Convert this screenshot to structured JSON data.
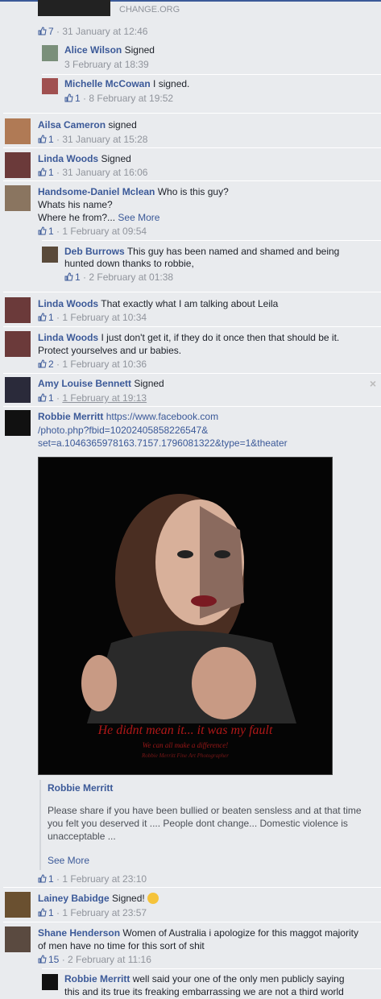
{
  "top_banner": {
    "source": "CHANGE.ORG",
    "likes": "7",
    "date": "31 January at 12:46"
  },
  "replies_1": [
    {
      "name": "Alice Wilson",
      "text": "Signed",
      "likes": "",
      "date": "3 February at 18:39"
    },
    {
      "name": "Michelle McCowan",
      "text": "I signed.",
      "likes": "1",
      "date": "8 February at 19:52"
    }
  ],
  "comments": [
    {
      "name": "Ailsa Cameron",
      "text": "signed",
      "likes": "1",
      "date": "31 January at 15:28"
    },
    {
      "name": "Linda Woods",
      "text": "Signed",
      "likes": "1",
      "date": "31 January at 16:06"
    },
    {
      "name": "Handsome-Daniel Mclean",
      "text": "Who is this guy?",
      "line2": "Whats his name?",
      "line3": "Where he from?...",
      "see_more": "See More",
      "likes": "1",
      "date": "1 February at 09:54"
    },
    {
      "name": "Linda Woods",
      "text": "That exactly what I am talking about Leila",
      "likes": "1",
      "date": "1 February at 10:34"
    },
    {
      "name": "Linda Woods",
      "text": "I just don't get it, if they do it once then that should be it.",
      "line2": "Protect yourselves and ur babies.",
      "likes": "2",
      "date": "1 February at 10:36"
    },
    {
      "name": "Amy Louise Bennett",
      "text": "Signed",
      "likes": "1",
      "date": "1 February at 19:13"
    },
    {
      "name": "Robbie Merritt",
      "link1": "https://www.facebook.com",
      "link2": "/photo.php?fbid=10202405858226547&",
      "link3": "set=a.1046365978163.7157.1796081322&type=1&theater",
      "likes": "1",
      "date": "1 February at 23:10"
    },
    {
      "name": "Lainey Babidge",
      "text": "Signed!",
      "likes": "1",
      "date": "1 February at 23:57"
    },
    {
      "name": "Shane Henderson",
      "text": "Women of Australia i apologize for this maggot majority",
      "line2": "of men have no time for this sort of shit",
      "likes": "15",
      "date": "2 February at 11:16"
    }
  ],
  "reply_deb": {
    "name": "Deb Burrows",
    "text": "This guy has been named and shamed and being",
    "line2": "hunted down thanks to robbie,",
    "likes": "1",
    "date": "2 February at 01:38"
  },
  "reply_robbie": {
    "name": "Robbie Merritt",
    "text": "well said your one of the only men publicly saying",
    "line2": "this and its true its freaking embarrassing we are not a third world"
  },
  "photo": {
    "caption": "He didnt mean it... it was my fault",
    "subcaption": "We can all make a difference!",
    "credit": "Robbie Merritt Fine Art Photographer"
  },
  "share": {
    "author": "Robbie Merritt",
    "body1": "Please share if you have been bullied or beaten sensless and at that time",
    "body2": "you felt you deserved it .... People dont change... Domestic violence is",
    "body3": "unacceptable ...",
    "see_more": "See More"
  },
  "close_glyph": "×",
  "separator_dot": "·",
  "colors": {
    "link": "#3b5998",
    "meta": "#90949c",
    "bg": "#e9ebee"
  }
}
